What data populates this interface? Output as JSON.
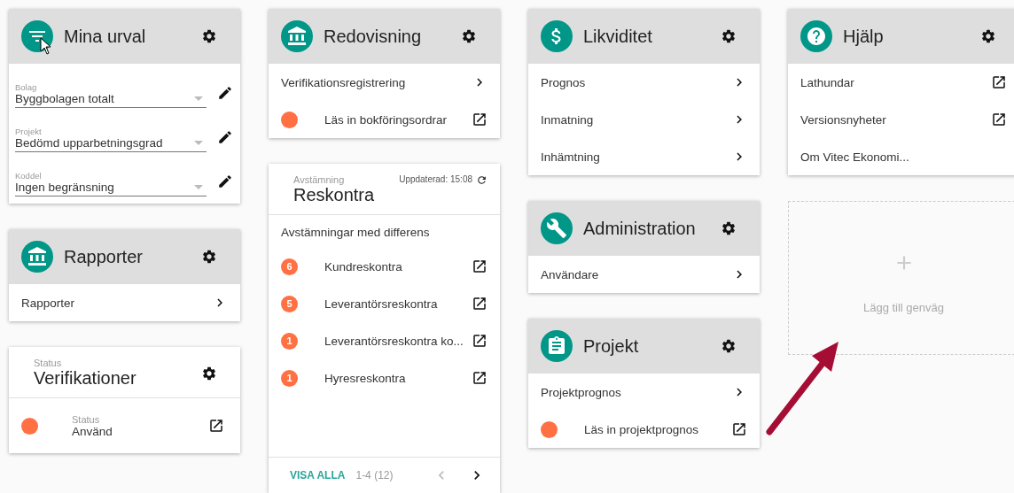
{
  "columns": [
    [
      {
        "kind": "selections",
        "title": "Mina urval",
        "fields": [
          {
            "label": "Bolag",
            "value": "Byggbolagen totalt"
          },
          {
            "label": "Projekt",
            "value": "Bedömd upparbetningsgrad"
          },
          {
            "label": "Koddel",
            "value": "Ingen begränsning"
          }
        ]
      },
      {
        "kind": "menu",
        "title": "Rapporter",
        "items": [
          {
            "kind": "nav",
            "label": "Rapporter"
          }
        ]
      },
      {
        "kind": "status",
        "subtitle": "Status",
        "title": "Verifikationer",
        "rows": [
          {
            "label": "Status",
            "value": "Använd"
          }
        ]
      }
    ],
    [
      {
        "kind": "menu",
        "title": "Redovisning",
        "items": [
          {
            "kind": "nav",
            "label": "Verifikationsregistrering"
          },
          {
            "kind": "status",
            "label": "Läs in bokföringsordrar"
          }
        ]
      },
      {
        "kind": "reconciliation",
        "subtitle": "Avstämning",
        "title": "Reskontra",
        "updated": "Uppdaterad: 15:08",
        "section": "Avstämningar med differens",
        "items": [
          {
            "count": "6",
            "label": "Kundreskontra"
          },
          {
            "count": "5",
            "label": "Leverantörsreskontra"
          },
          {
            "count": "1",
            "label": "Leverantörsreskontra ko..."
          },
          {
            "count": "1",
            "label": "Hyresreskontra"
          }
        ],
        "footer": {
          "link": "VISA ALLA",
          "range": "1-4 (12)",
          "prev_disabled": true,
          "next_disabled": false
        }
      }
    ],
    [
      {
        "kind": "menu",
        "title": "Likviditet",
        "items": [
          {
            "kind": "nav",
            "label": "Prognos"
          },
          {
            "kind": "nav",
            "label": "Inmatning"
          },
          {
            "kind": "nav",
            "label": "Inhämtning"
          }
        ]
      },
      {
        "kind": "menu",
        "title": "Administration",
        "items": [
          {
            "kind": "nav",
            "label": "Användare"
          }
        ]
      },
      {
        "kind": "menu",
        "title": "Projekt",
        "items": [
          {
            "kind": "nav",
            "label": "Projektprognos"
          },
          {
            "kind": "status",
            "label": "Läs in projektprognos"
          }
        ]
      }
    ],
    [
      {
        "kind": "menu",
        "title": "Hjälp",
        "items": [
          {
            "kind": "external",
            "label": "Lathundar"
          },
          {
            "kind": "external",
            "label": "Versionsnyheter"
          },
          {
            "kind": "plain",
            "label": "Om Vitec Ekonomi..."
          }
        ]
      },
      {
        "kind": "add",
        "label": "Lägg till genväg"
      }
    ]
  ]
}
